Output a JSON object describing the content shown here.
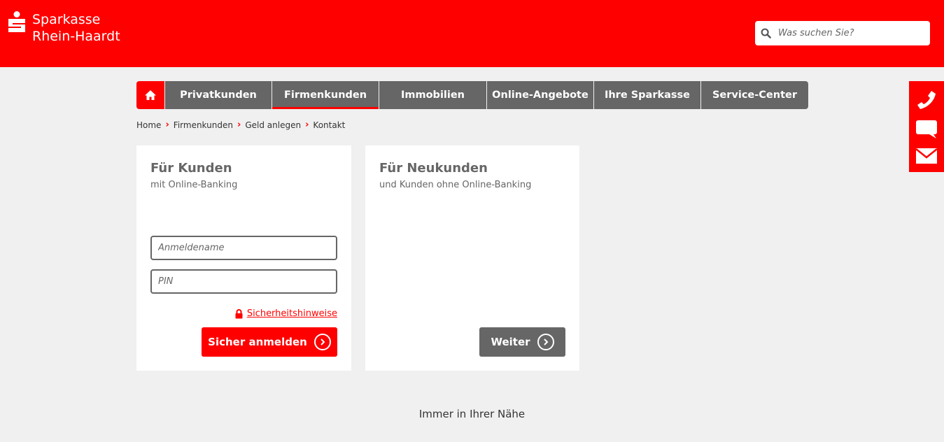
{
  "brand": {
    "line1": "Sparkasse",
    "line2": "Rhein-Haardt",
    "color": "#ff0000"
  },
  "search": {
    "placeholder": "Was suchen Sie?",
    "icon": "search-icon"
  },
  "nav": {
    "home_icon": "home-icon",
    "items": [
      {
        "label": "Privatkunden"
      },
      {
        "label": "Firmenkunden",
        "active": true
      },
      {
        "label": "Immobilien"
      },
      {
        "label": "Online-Angebote"
      },
      {
        "label": "Ihre Sparkasse"
      },
      {
        "label": "Service-Center"
      }
    ]
  },
  "breadcrumb": [
    "Home",
    "Firmenkunden",
    "Geld anlegen",
    "Kontakt"
  ],
  "login_card": {
    "title": "Für Kunden",
    "subtitle": "mit Online-Banking",
    "username_placeholder": "Anmeldename",
    "pin_placeholder": "PIN",
    "security_link": "Sicherheitshinweise",
    "submit_label": "Sicher anmelden"
  },
  "new_card": {
    "title": "Für Neukunden",
    "subtitle": "und Kunden ohne Online-Banking",
    "button_label": "Weiter"
  },
  "side_contacts": [
    "phone-icon",
    "chat-icon",
    "mail-icon"
  ],
  "footer": {
    "heading": "Immer in Ihrer Nähe"
  }
}
